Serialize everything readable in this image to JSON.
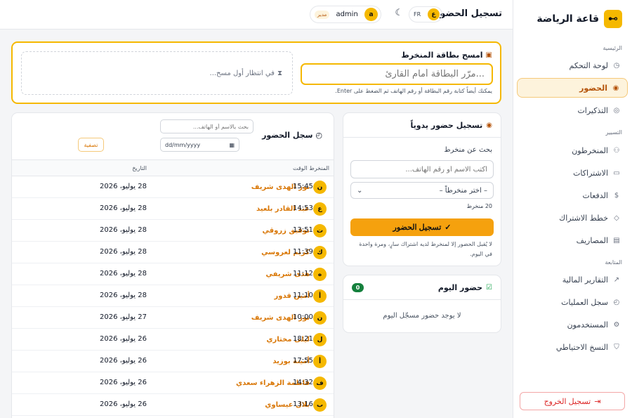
{
  "sidebar": {
    "brand": "قاعة الرياضة",
    "logout": "تسجيل الخروج",
    "sections": [
      {
        "label": "الرئيسية"
      },
      {
        "label": "التسيير"
      },
      {
        "label": "المتابعة"
      }
    ],
    "items": [
      {
        "label": "لوحة التحكم",
        "icon": "dashboard-icon"
      },
      {
        "label": "الحضور",
        "icon": "fingerprint-icon",
        "active": true
      },
      {
        "label": "التذكيرات",
        "icon": "whatsapp-icon"
      },
      {
        "label": "المنخرطون",
        "icon": "users-icon"
      },
      {
        "label": "الاشتراكات",
        "icon": "card-icon"
      },
      {
        "label": "الدفعات",
        "icon": "money-icon"
      },
      {
        "label": "خطط الاشتراك",
        "icon": "tag-icon"
      },
      {
        "label": "المصاريف",
        "icon": "receipt-icon"
      },
      {
        "label": "التقارير المالية",
        "icon": "chart-icon"
      },
      {
        "label": "سجل العمليات",
        "icon": "clock-icon"
      },
      {
        "label": "المستخدمون",
        "icon": "user-cog-icon"
      },
      {
        "label": "النسخ الاحتياطي",
        "icon": "shield-icon"
      }
    ]
  },
  "topbar": {
    "title": "تسجيل الحضور",
    "lang_ar": "ع",
    "lang_fr": "FR",
    "user_initial": "a",
    "user_name": "admin",
    "user_role": "مدير"
  },
  "scan": {
    "title": "امسح بطاقة المنخرط",
    "placeholder": "...مرّر البطاقة أمام القارئ",
    "hint": "يمكنك أيضاً كتابة رقم البطاقة أو رقم الهاتف ثم الضغط على Enter.",
    "waiting": "في انتظار أول مسح..."
  },
  "manual": {
    "title": "تسجيل حضور يدوياً",
    "search_label": "بحث عن منخرط",
    "search_placeholder": "اكتب الاسم أو رقم الهاتف...",
    "select_value": "– اختر منخرطاً –",
    "count": "20 منخرط",
    "button": "تسجيل الحضور",
    "note": "لا يُقبل الحضور إلا لمنخرط لديه اشتراك سارٍ، ومرة واحدة في اليوم."
  },
  "today": {
    "title": "حضور اليوم",
    "count": "0",
    "empty": "لا يوجد حضور مسجّل اليوم"
  },
  "attendance": {
    "title": "سجل الحضور",
    "search_placeholder": "بحث بالاسم أو الهاتف...",
    "date_placeholder": "dd/mm/yyyy",
    "filter": "تصفية",
    "columns": {
      "member": "المنخرط",
      "date": "التاريخ",
      "time": "الوقت"
    },
    "rows": [
      {
        "initial": "ن",
        "name": "نور الهدى شريف",
        "date": "28 يوليو، 2026",
        "time": "15:45"
      },
      {
        "initial": "ع",
        "name": "عبد القادر بلعيد",
        "date": "28 يوليو، 2026",
        "time": "14:53"
      },
      {
        "initial": "ت",
        "name": "توفيق زروقي",
        "date": "28 يوليو، 2026",
        "time": "13:51"
      },
      {
        "initial": "ك",
        "name": "كريم لعروسي",
        "date": "28 يوليو، 2026",
        "time": "11:39"
      },
      {
        "initial": "ه",
        "name": "هدى شريفي",
        "date": "28 يوليو، 2026",
        "time": "11:12"
      },
      {
        "initial": "أ",
        "name": "أمين قدور",
        "date": "28 يوليو، 2026",
        "time": "11:10"
      },
      {
        "initial": "ن",
        "name": "نور الهدى شريف",
        "date": "27 يوليو، 2026",
        "time": "10:00"
      },
      {
        "initial": "ل",
        "name": "ليلى مختاري",
        "date": "26 يوليو، 2026",
        "time": "18:21"
      },
      {
        "initial": "أ",
        "name": "أمينة بوزيد",
        "date": "26 يوليو، 2026",
        "time": "17:55"
      },
      {
        "initial": "ف",
        "name": "فاطمة الزهراء سعدي",
        "date": "26 يوليو، 2026",
        "time": "14:32"
      },
      {
        "initial": "ب",
        "name": "بلال عيساوي",
        "date": "26 يوليو، 2026",
        "time": "13:16"
      }
    ]
  }
}
